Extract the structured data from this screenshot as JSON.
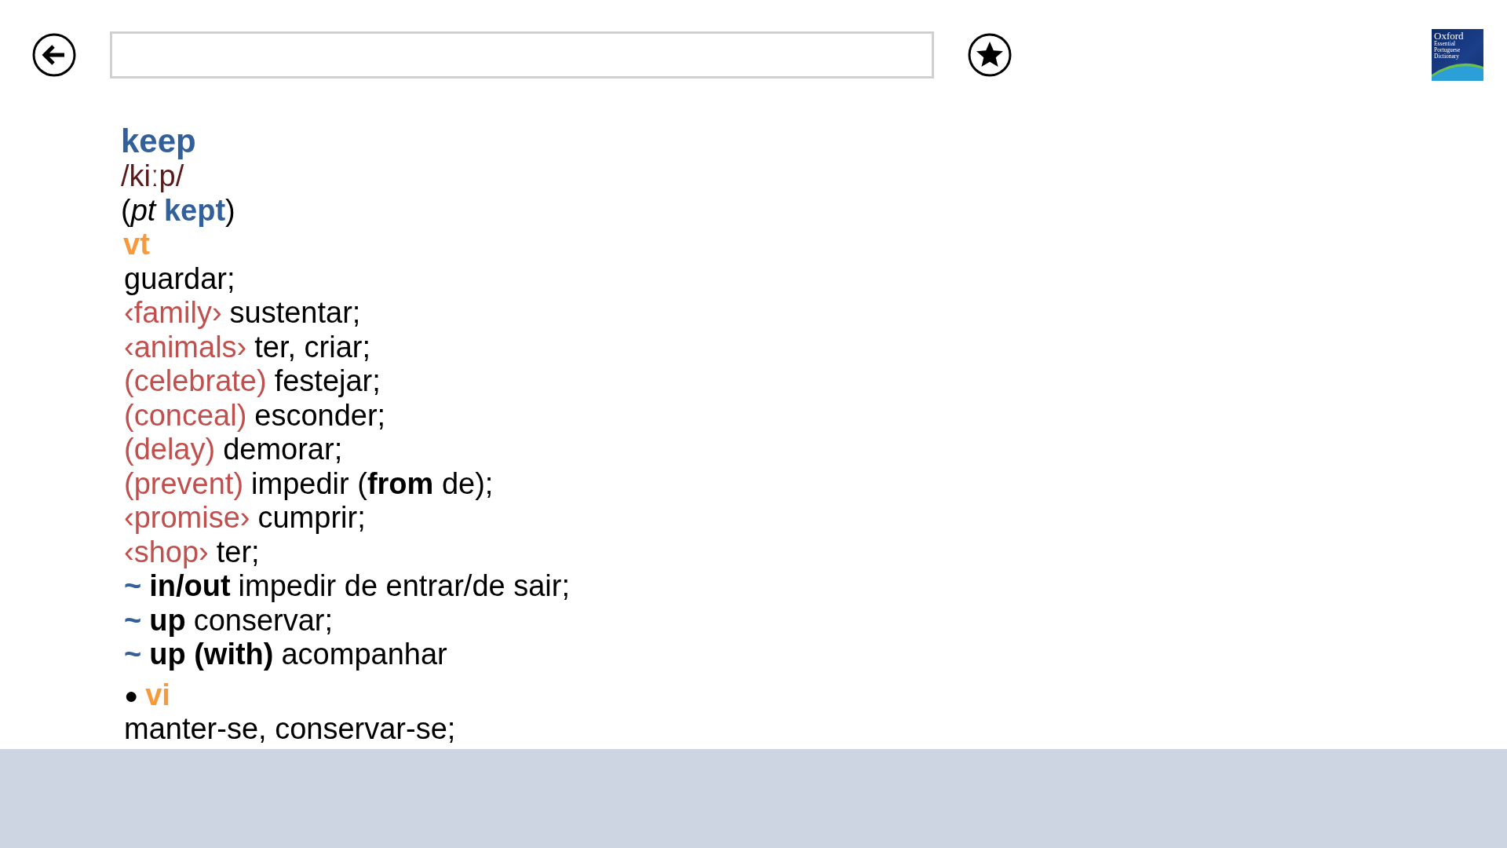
{
  "logo": {
    "lines": [
      "Oxford",
      "Essential",
      "Portuguese",
      "Dictionary"
    ]
  },
  "entry": {
    "headword": "keep",
    "pronunciation": "/kiːp/",
    "inflection": "(*pt* **kept**)",
    "part_of_speech": "vt",
    "senses": [
      {
        "kind": "sense",
        "translation": "guardar;"
      },
      {
        "kind": "sense",
        "indicator": "‹family›",
        "translation": "sustentar;"
      },
      {
        "kind": "sense",
        "indicator": "‹animals›",
        "translation": "ter, criar;"
      },
      {
        "kind": "sense",
        "indicator": "(celebrate)",
        "translation": "festejar;"
      },
      {
        "kind": "sense",
        "indicator": "(conceal)",
        "translation": "esconder;"
      },
      {
        "kind": "sense",
        "indicator": "(delay)",
        "translation": "demorar;"
      },
      {
        "kind": "sense",
        "indicator": "(prevent)",
        "translation": "impedir (**from** de);"
      },
      {
        "kind": "sense",
        "indicator": "‹promise›",
        "translation": "cumprir;"
      },
      {
        "kind": "sense",
        "indicator": "‹shop›",
        "translation": "ter;"
      },
      {
        "kind": "phrase",
        "tilde": "~",
        "phrase": "in/out",
        "translation": "impedir de entrar/de sair;"
      },
      {
        "kind": "phrase",
        "tilde": "~",
        "phrase": "up",
        "translation": "conservar;"
      },
      {
        "kind": "phrase",
        "tilde": "~",
        "phrase": "up (with)",
        "translation": "acompanhar"
      }
    ],
    "second_part_of_speech": {
      "bullet": "●",
      "label": "vi"
    },
    "second_senses": [
      {
        "kind": "sense",
        "translation": "manter-se, conservar-se;"
      }
    ]
  }
}
